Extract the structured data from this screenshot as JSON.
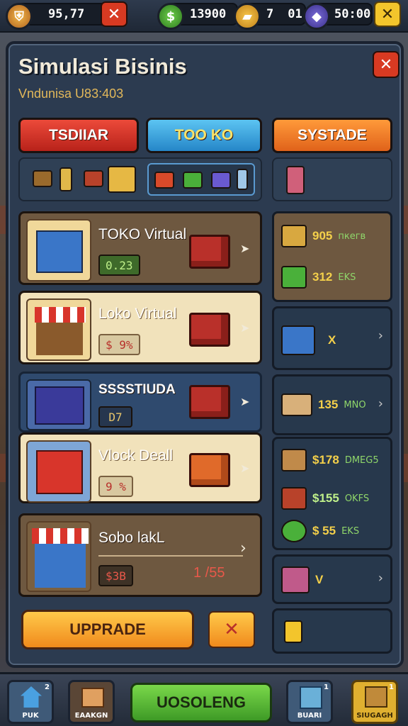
{
  "topbar": {
    "coins_value": "95,77",
    "cash_value": "13900",
    "gold_value": "7",
    "gold_value_2": "01",
    "gems_value": "50:00"
  },
  "panel": {
    "title": "Simulasi Bisinis",
    "subtitle": "Vndunisa U83:403",
    "close_glyph": "✕"
  },
  "tabs": [
    {
      "label": "TSDIIAR"
    },
    {
      "label": "TOO KO"
    },
    {
      "label": "SYSTADE"
    }
  ],
  "cards": [
    {
      "name": "TOKO Virtual",
      "value": "0.23"
    },
    {
      "name": "Loko Virtual",
      "value": "$ 9%"
    },
    {
      "name": "SSSSTIUDA",
      "value": "D7"
    },
    {
      "name": "Vlock Deall",
      "value": "9 %"
    },
    {
      "name": "Sobo lakL",
      "value": "$3B",
      "amount": "1 /55"
    }
  ],
  "side_items": [
    {
      "price": "905",
      "sub": "пкегв"
    },
    {
      "price": "312",
      "sub": "EKS"
    },
    {
      "price": "X",
      "sub": ""
    },
    {
      "price": "135",
      "sub": "MNO"
    },
    {
      "price": "$178",
      "sub": "DMEG5"
    },
    {
      "price": "$155",
      "sub": "OKFS"
    },
    {
      "price": "$ 55",
      "sub": "EKS"
    },
    {
      "price": "V",
      "sub": ""
    }
  ],
  "buttons": {
    "upgrade_label": "UPPRADE",
    "cancel_glyph": "✕",
    "main_label": "UOSOLENG"
  },
  "bottom_nav": [
    {
      "label": "PUK"
    },
    {
      "label": "EAAKGN"
    },
    {
      "label": "BUARI"
    },
    {
      "label": "SIUGAGH"
    }
  ],
  "colors": {
    "tab_red": "#d8352b",
    "tab_blue": "#3aa4e0",
    "tab_orange": "#f07a1e",
    "accent_gold": "#f4d04a",
    "green_btn": "#56b43a"
  }
}
